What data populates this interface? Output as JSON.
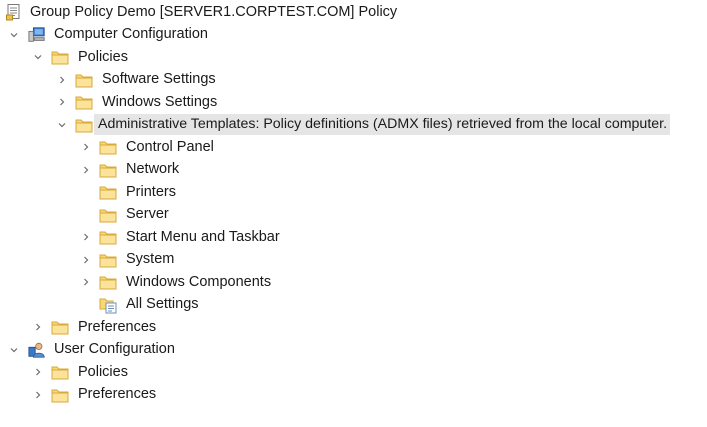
{
  "root": {
    "label": "Group Policy Demo [SERVER1.CORPTEST.COM] Policy",
    "icon": "policy-document-icon"
  },
  "computer_config": {
    "label": "Computer Configuration",
    "icon": "computer-icon",
    "policies": {
      "label": "Policies",
      "software_settings": "Software Settings",
      "windows_settings": "Windows Settings",
      "admin_templates": {
        "label": "Administrative Templates: Policy definitions (ADMX files) retrieved from the local computer.",
        "control_panel": "Control Panel",
        "network": "Network",
        "printers": "Printers",
        "server": "Server",
        "start_menu": "Start Menu and Taskbar",
        "system": "System",
        "windows_components": "Windows Components",
        "all_settings": "All Settings"
      }
    },
    "preferences": "Preferences"
  },
  "user_config": {
    "label": "User Configuration",
    "icon": "user-icon",
    "policies": "Policies",
    "preferences": "Preferences"
  },
  "colors": {
    "folder_fill": "#f8d775",
    "folder_edge": "#d9a93a",
    "selection": "#e5e5e5",
    "chevron": "#6b6b6b"
  }
}
